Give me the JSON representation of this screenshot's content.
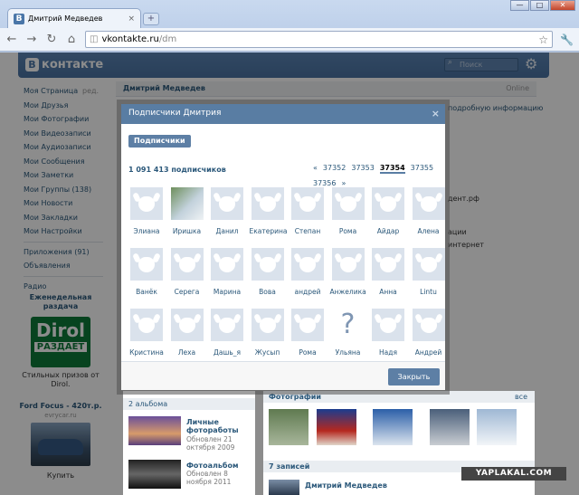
{
  "browser": {
    "tab_title": "Дмитрий Медведев",
    "tab_close": "×",
    "new_tab": "+",
    "url_domain": "vkontakte.ru",
    "url_path": "/dm",
    "back": "←",
    "forward": "→",
    "reload": "↻",
    "home": "⌂",
    "star": "☆",
    "wrench": "🔧",
    "window": {
      "min": "—",
      "max": "□",
      "close": "✕"
    }
  },
  "vk": {
    "logo_letter": "B",
    "logo_text": "контакте",
    "search_placeholder": "Поиск",
    "search_icon": "⌕",
    "gear": "⚙"
  },
  "sidebar": {
    "edit_label": "ред.",
    "items": [
      "Моя Страница",
      "Мои Друзья",
      "Мои Фотографии",
      "Мои Видеозаписи",
      "Мои Аудиозаписи",
      "Мои Сообщения",
      "Мои Заметки",
      "Мои Группы (138)",
      "Мои Новости",
      "Мои Закладки",
      "Мои Настройки"
    ],
    "items2": [
      "Приложения (91)",
      "Объявления"
    ],
    "items3": [
      "Радио"
    ]
  },
  "promo": {
    "title": "Еженедельная раздача",
    "brand": "Dirol",
    "brand_sub": "РАЗДАЕТ",
    "text": "Стильных призов от Dirol."
  },
  "ad": {
    "title": "Ford Focus - 420т.р.",
    "site": "evrycar.ru",
    "buy": "Купить"
  },
  "profile": {
    "name": "Дмитрий Медведев",
    "status": "Online",
    "info_link": "подробную информацию",
    "frag1": "дент.рф",
    "frag2": "ации",
    "frag3": "интернет"
  },
  "modal": {
    "title": "Подписчики Дмитрия",
    "close": "×",
    "tab_label": "Подписчики",
    "count": "1 091 413 подписчиков",
    "pager": [
      "«",
      "37352",
      "37353",
      "37354",
      "37355",
      "37356",
      "»"
    ],
    "current_page": "37354",
    "users": [
      "Элиана",
      "Иришка",
      "Данил",
      "Екатерина",
      "Степан",
      "Рома",
      "Айдар",
      "Алена",
      "Ванёк",
      "Серега",
      "Марина",
      "Вова",
      "андрей",
      "Анжелика",
      "Анна",
      "Lintu",
      "Кристина",
      "Леха",
      "Дашь_я",
      "Жусып",
      "Рома",
      "Ульяна",
      "Надя",
      "Андрей"
    ],
    "close_button": "Закрыть",
    "question_mark": "?"
  },
  "albums": {
    "header": "2 альбома",
    "items": [
      {
        "title": "Личные фотоработы",
        "meta": "Обновлен 21 октября 2009"
      },
      {
        "title": "Фотоальбом",
        "meta": "Обновлен 8 ноября 2011"
      }
    ]
  },
  "photos": {
    "header": "Фотографии",
    "all": "все"
  },
  "wall": {
    "header": "7 записей",
    "author": "Дмитрий Медведев"
  },
  "watermark": "YAPLAKAL.COM"
}
